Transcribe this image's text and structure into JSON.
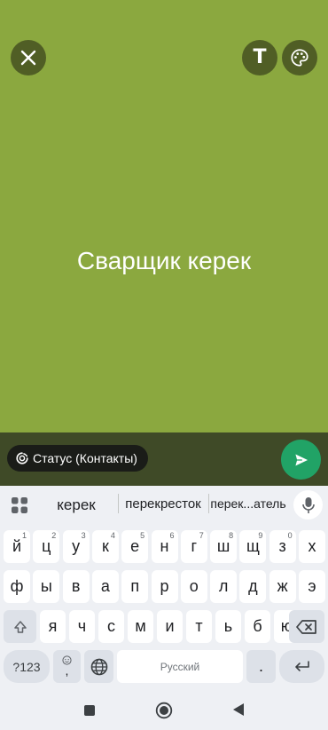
{
  "app": {
    "status_text": "Сварщик керек",
    "audience_label": "Статус (Контакты)",
    "text_tool_label": "T",
    "background_color": "#8ba83f",
    "send_color": "#21a366"
  },
  "toolbar": {
    "close_icon": "close-icon",
    "text_icon": "text-format-icon",
    "palette_icon": "palette-icon"
  },
  "keyboard": {
    "suggestions": [
      "керек",
      "перекресток",
      "перек...атель"
    ],
    "row1": [
      {
        "label": "й",
        "hint": "1"
      },
      {
        "label": "ц",
        "hint": "2"
      },
      {
        "label": "у",
        "hint": "3"
      },
      {
        "label": "к",
        "hint": "4"
      },
      {
        "label": "е",
        "hint": "5"
      },
      {
        "label": "н",
        "hint": "6"
      },
      {
        "label": "г",
        "hint": "7"
      },
      {
        "label": "ш",
        "hint": "8"
      },
      {
        "label": "щ",
        "hint": "9"
      },
      {
        "label": "з",
        "hint": "0"
      },
      {
        "label": "х",
        "hint": ""
      }
    ],
    "row2": [
      "ф",
      "ы",
      "в",
      "а",
      "п",
      "р",
      "о",
      "л",
      "д",
      "ж",
      "э"
    ],
    "row3": [
      "я",
      "ч",
      "с",
      "м",
      "и",
      "т",
      "ь",
      "б",
      "ю"
    ],
    "symbols_label": "?123",
    "emoji_comma": ",",
    "space_label": "Русский",
    "period_label": "."
  }
}
